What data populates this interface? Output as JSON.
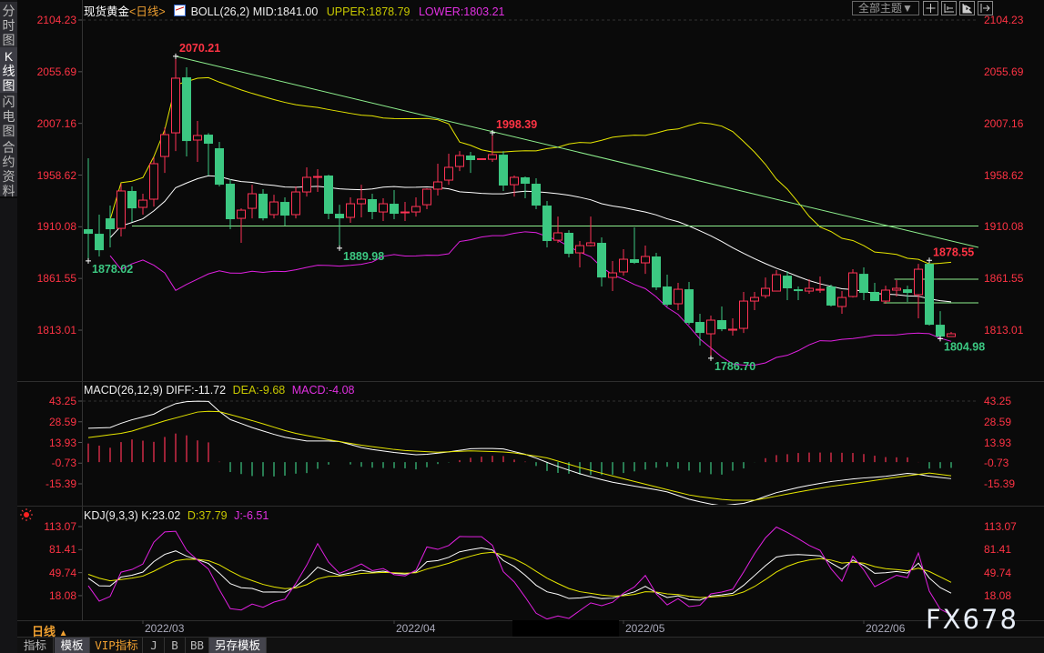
{
  "sidebar": {
    "tabs": [
      {
        "label": "分时图",
        "selected": false
      },
      {
        "label": "K线图",
        "selected": true
      },
      {
        "label": "闪电图",
        "selected": false
      },
      {
        "label": "合约资料",
        "selected": false
      }
    ]
  },
  "header": {
    "instrument": "现货黄金",
    "period": "<日线>",
    "boll_name": "BOLL(26,2)",
    "mid": "MID:1841.00",
    "upper": "UPPER:1878.79",
    "lower": "LOWER:1803.21",
    "theme_button": "全部主题▼",
    "tool_icons": [
      "crosshair-icon",
      "zoom-range-icon",
      "play-icon",
      "goto-end-icon"
    ]
  },
  "colors": {
    "up": "#ff3355",
    "down": "#3cc882",
    "axis": "#ff3344",
    "mid": "#ffffff",
    "upper": "#e6e600",
    "lower": "#e020e0",
    "trend": "#8ef08e"
  },
  "main_axis": {
    "ticks": [
      "2104.23",
      "2055.69",
      "2007.16",
      "1958.62",
      "1910.08",
      "1861.55",
      "1813.01"
    ]
  },
  "macd": {
    "title": "MACD(26,12,9)",
    "diff": "DIFF:-11.72",
    "dea": "DEA:-9.68",
    "macd": "MACD:-4.08",
    "ticks": [
      "43.25",
      "28.59",
      "13.93",
      "-0.73",
      "-15.39"
    ],
    "diff_points": [
      [
        0,
        24
      ],
      [
        2,
        24.5
      ],
      [
        3.5,
        29
      ],
      [
        6,
        34
      ],
      [
        7.7,
        41
      ],
      [
        9.3,
        43.3
      ],
      [
        11,
        43
      ],
      [
        12.7,
        31
      ],
      [
        15,
        24.5
      ],
      [
        17.7,
        18
      ],
      [
        20,
        15
      ],
      [
        22.8,
        15
      ],
      [
        25.3,
        9.7
      ],
      [
        27.8,
        7
      ],
      [
        30.3,
        5
      ],
      [
        32.8,
        7
      ],
      [
        35.2,
        9.7
      ],
      [
        37.8,
        9.7
      ],
      [
        40.3,
        5
      ],
      [
        42.8,
        -2.6
      ],
      [
        45.3,
        -9
      ],
      [
        47.8,
        -14
      ],
      [
        50.3,
        -17.4
      ],
      [
        52.8,
        -20.6
      ],
      [
        55.3,
        -27
      ],
      [
        57.8,
        -31
      ],
      [
        60.3,
        -29
      ],
      [
        62.8,
        -22
      ],
      [
        65.3,
        -17.4
      ],
      [
        67.8,
        -14
      ],
      [
        70.3,
        -11.6
      ],
      [
        72.8,
        -10.3
      ],
      [
        75.3,
        -7.7
      ],
      [
        77,
        -10
      ],
      [
        79,
        -11.72
      ]
    ],
    "dea_points": [
      [
        0,
        17.4
      ],
      [
        3.6,
        21
      ],
      [
        6.9,
        29
      ],
      [
        10.25,
        36
      ],
      [
        11.9,
        36
      ],
      [
        15.2,
        29
      ],
      [
        18.6,
        21
      ],
      [
        21.9,
        16
      ],
      [
        25.3,
        11.6
      ],
      [
        28.6,
        8.4
      ],
      [
        31.9,
        7
      ],
      [
        35.2,
        8
      ],
      [
        38.6,
        7
      ],
      [
        41.9,
        3.2
      ],
      [
        45.3,
        -4.5
      ],
      [
        48.6,
        -11
      ],
      [
        51.9,
        -17.4
      ],
      [
        55.3,
        -23.8
      ],
      [
        58.6,
        -27
      ],
      [
        61.1,
        -27
      ],
      [
        64.4,
        -22
      ],
      [
        67.8,
        -17.4
      ],
      [
        71.1,
        -14
      ],
      [
        74.4,
        -10.3
      ],
      [
        77,
        -7.7
      ],
      [
        79,
        -9.68
      ]
    ]
  },
  "kdj": {
    "title": "KDJ(9,3,3)",
    "k": "K:23.02",
    "d": "D:37.79",
    "j": "J:-6.51",
    "ticks": [
      "113.07",
      "81.41",
      "49.74",
      "18.08"
    ]
  },
  "chart_data": {
    "type": "candlestick",
    "title": "现货黄金 日线",
    "ohlc_format": [
      "open",
      "high",
      "low",
      "close"
    ],
    "candles": [
      [
        1907.8,
        1974.4,
        1878.0,
        1903.5
      ],
      [
        1903.5,
        1921.5,
        1882.2,
        1888.1
      ],
      [
        1918.0,
        1930.0,
        1890.7,
        1907.8
      ],
      [
        1908.6,
        1950.5,
        1901.0,
        1943.7
      ],
      [
        1943.7,
        1947.9,
        1914.6,
        1927.4
      ],
      [
        1928.3,
        1941.1,
        1921.5,
        1935.1
      ],
      [
        1936.0,
        1975.3,
        1929.1,
        1969.3
      ],
      [
        1976.1,
        2003.4,
        1960.7,
        1996.6
      ],
      [
        1998.3,
        2070.2,
        1981.2,
        2049.6
      ],
      [
        2050.4,
        2059.8,
        1976.1,
        1990.6
      ],
      [
        1991.5,
        2009.4,
        1971.0,
        1995.8
      ],
      [
        1996.6,
        1998.0,
        1958.2,
        1988.1
      ],
      [
        1983.8,
        1989.8,
        1948.0,
        1949.6
      ],
      [
        1950.5,
        1954.8,
        1907.8,
        1917.2
      ],
      [
        1918.0,
        1927.4,
        1895.0,
        1925.7
      ],
      [
        1927.4,
        1949.6,
        1918.0,
        1941.1
      ],
      [
        1941.1,
        1945.4,
        1916.0,
        1918.0
      ],
      [
        1921.5,
        1940.2,
        1918.0,
        1933.4
      ],
      [
        1933.4,
        1937.7,
        1911.2,
        1920.6
      ],
      [
        1921.5,
        1947.9,
        1918.0,
        1942.8
      ],
      [
        1942.8,
        1965.9,
        1938.5,
        1956.5
      ],
      [
        1956.5,
        1964.2,
        1942.8,
        1957.3
      ],
      [
        1958.2,
        1959.0,
        1917.2,
        1922.3
      ],
      [
        1922.3,
        1930.8,
        1889.98,
        1918.0
      ],
      [
        1918.9,
        1937.7,
        1913.8,
        1931.7
      ],
      [
        1931.7,
        1949.6,
        1918.9,
        1936.0
      ],
      [
        1936.0,
        1941.1,
        1917.2,
        1924.0
      ],
      [
        1924.0,
        1936.8,
        1915.5,
        1931.7
      ],
      [
        1931.7,
        1944.5,
        1917.2,
        1922.3
      ],
      [
        1923.2,
        1933.4,
        1915.5,
        1924.0
      ],
      [
        1924.0,
        1937.7,
        1919.7,
        1929.1
      ],
      [
        1930.8,
        1946.2,
        1926.6,
        1945.4
      ],
      [
        1945.4,
        1969.3,
        1939.4,
        1952.2
      ],
      [
        1953.9,
        1978.7,
        1949.6,
        1965.9
      ],
      [
        1966.7,
        1981.2,
        1962.4,
        1977.0
      ],
      [
        1977.0,
        1980.4,
        1960.7,
        1972.7
      ],
      [
        1973.5,
        1974.4,
        1972.7,
        1974.0
      ],
      [
        1973.5,
        1998.39,
        1971.0,
        1977.8
      ],
      [
        1977.8,
        1981.2,
        1943.7,
        1948.8
      ],
      [
        1949.6,
        1958.2,
        1938.5,
        1956.5
      ],
      [
        1956.5,
        1957.3,
        1936.8,
        1950.5
      ],
      [
        1950.5,
        1955.6,
        1926.6,
        1930.0
      ],
      [
        1930.0,
        1934.3,
        1890.7,
        1896.7
      ],
      [
        1897.5,
        1919.7,
        1895.0,
        1904.4
      ],
      [
        1904.4,
        1906.9,
        1881.3,
        1884.7
      ],
      [
        1885.6,
        1896.7,
        1871.9,
        1892.4
      ],
      [
        1892.4,
        1919.7,
        1891.6,
        1895.0
      ],
      [
        1895.0,
        1900.1,
        1854.0,
        1862.5
      ],
      [
        1862.5,
        1877.9,
        1849.7,
        1866.8
      ],
      [
        1867.7,
        1889.0,
        1864.2,
        1879.6
      ],
      [
        1879.6,
        1909.5,
        1875.3,
        1876.2
      ],
      [
        1876.2,
        1892.4,
        1865.9,
        1882.2
      ],
      [
        1882.2,
        1885.6,
        1850.6,
        1853.1
      ],
      [
        1854.0,
        1865.1,
        1835.2,
        1836.9
      ],
      [
        1837.8,
        1857.4,
        1831.8,
        1851.4
      ],
      [
        1851.4,
        1858.3,
        1818.0,
        1819.8
      ],
      [
        1820.7,
        1828.4,
        1798.5,
        1810.4
      ],
      [
        1809.6,
        1826.7,
        1786.7,
        1822.4
      ],
      [
        1822.4,
        1835.2,
        1812.1,
        1813.9
      ],
      [
        1813.0,
        1824.1,
        1807.9,
        1813.9
      ],
      [
        1814.7,
        1848.9,
        1810.4,
        1840.3
      ],
      [
        1840.3,
        1848.9,
        1831.8,
        1843.7
      ],
      [
        1845.4,
        1862.5,
        1842.9,
        1852.3
      ],
      [
        1849.7,
        1869.4,
        1849.7,
        1865.1
      ],
      [
        1864.2,
        1868.5,
        1841.2,
        1852.3
      ],
      [
        1851.4,
        1854.0,
        1841.2,
        1849.7
      ],
      [
        1849.7,
        1860.8,
        1847.2,
        1852.3
      ],
      [
        1851.0,
        1863.4,
        1848.0,
        1851.4
      ],
      [
        1854.0,
        1855.7,
        1835.2,
        1836.1
      ],
      [
        1835.2,
        1849.7,
        1828.4,
        1843.7
      ],
      [
        1844.6,
        1870.2,
        1843.7,
        1866.8
      ],
      [
        1865.9,
        1872.0,
        1841.2,
        1848.0
      ],
      [
        1848.9,
        1857.4,
        1840.3,
        1840.3
      ],
      [
        1840.3,
        1854.8,
        1837.8,
        1850.6
      ],
      [
        1850.6,
        1860.0,
        1844.6,
        1852.3
      ],
      [
        1851.4,
        1854.8,
        1839.5,
        1848.0
      ],
      [
        1846.3,
        1875.3,
        1824.1,
        1870.2
      ],
      [
        1875.3,
        1878.55,
        1817.3,
        1818.1
      ],
      [
        1818.1,
        1830.9,
        1804.98,
        1807.0
      ],
      [
        1807.0,
        1811.3,
        1807.0,
        1809.6
      ]
    ],
    "price_labels": [
      {
        "text": "2070.21",
        "candle": 8,
        "price": 2070.21,
        "kind": "high"
      },
      {
        "text": "1878.02",
        "candle": 0,
        "price": 1878.02,
        "kind": "low"
      },
      {
        "text": "1889.98",
        "candle": 23,
        "price": 1889.98,
        "kind": "low"
      },
      {
        "text": "1998.39",
        "candle": 37,
        "price": 1998.39,
        "kind": "high"
      },
      {
        "text": "1786.70",
        "candle": 57,
        "price": 1786.7,
        "kind": "low"
      },
      {
        "text": "1878.55",
        "candle": 77,
        "price": 1878.55,
        "kind": "high"
      },
      {
        "text": "1804.98",
        "candle": 78,
        "price": 1804.98,
        "kind": "low"
      }
    ],
    "trendlines": [
      {
        "from": [
          8,
          2070.21
        ],
        "to": [
          81.5,
          1890.7
        ]
      },
      {
        "from": [
          4,
          1910.8
        ],
        "to": [
          81.5,
          1910.8
        ]
      },
      {
        "from": [
          73.8,
          1860.8
        ],
        "to": [
          81.5,
          1860.8
        ]
      },
      {
        "from": [
          72.8,
          1838.6
        ],
        "to": [
          81.5,
          1838.6
        ]
      }
    ],
    "boll_period": 26,
    "boll_k": 2,
    "x_labels": [
      {
        "text": "2022/03",
        "candle": 5
      },
      {
        "text": "2022/04",
        "candle": 28
      },
      {
        "text": "2022/05",
        "candle": 49
      },
      {
        "text": "2022/06",
        "candle": 71
      }
    ],
    "ylim": [
      1766,
      2104.23
    ]
  },
  "footer": {
    "period_label": "日线",
    "period_arrow": "▲",
    "tabs": [
      "指标",
      "模板",
      "VIP指标",
      "J",
      "B",
      "BB",
      "另存模板"
    ],
    "watermark": "FX678"
  }
}
